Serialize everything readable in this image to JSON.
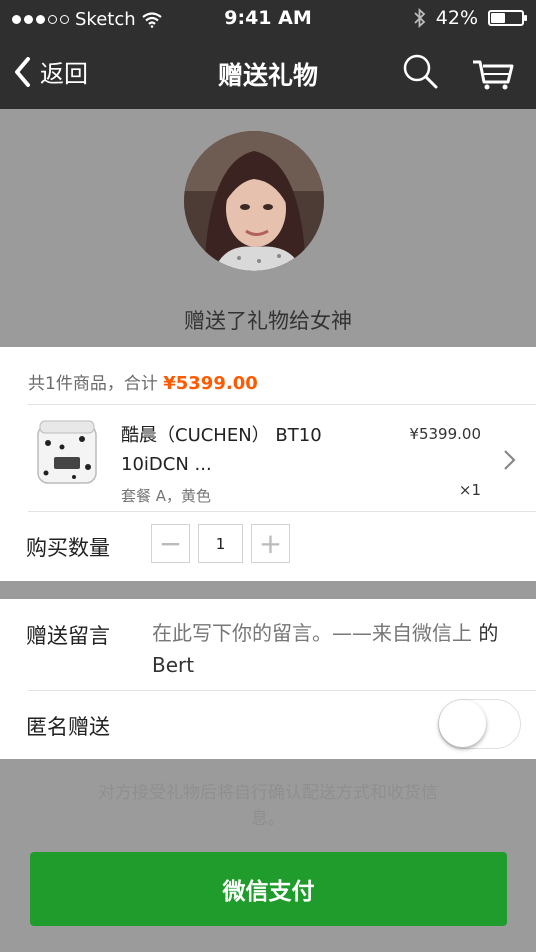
{
  "status_bar": {
    "carrier": "Sketch",
    "time": "9:41 AM",
    "battery": "42%",
    "battery_level": 0.42,
    "signal_bars": 3,
    "icons": [
      "signal-dots-icon",
      "wifi-icon",
      "bluetooth-icon",
      "battery-icon"
    ]
  },
  "nav": {
    "back_label": "返回",
    "title": "赠送礼物",
    "icons": [
      "back-chevron-icon",
      "search-icon",
      "cart-icon"
    ]
  },
  "recipient": {
    "text": "赠送了礼物给女神",
    "avatar_icon": "avatar-photo"
  },
  "order": {
    "summary_prefix": "共1件商品，合计",
    "total": "¥5399.00",
    "product": {
      "name": "酷晨（CUCHEN） BT10 10iDCN ...",
      "variant": "套餐 A，黄色",
      "price": "¥5399.00",
      "qty": "×1",
      "image_icon": "rice-cooker-image"
    },
    "quantity_label": "购买数量",
    "quantity_value": "1",
    "minus": "−",
    "plus": "+"
  },
  "message": {
    "label": "赠送留言",
    "placeholder_main": "在此写下你的留言。——来自微信上",
    "placeholder_author": "的 Bert"
  },
  "anonymous": {
    "label": "匿名赠送",
    "enabled": false
  },
  "hint": "对方接受礼物后将自行确认配送方式和收货信息。",
  "pay_button": "微信支付",
  "colors": {
    "accent_price": "#ff5a00",
    "pay_green": "#1f9c2b",
    "nav_bg": "#2f2f2f",
    "overlay_bg": "#9b9b9b"
  }
}
